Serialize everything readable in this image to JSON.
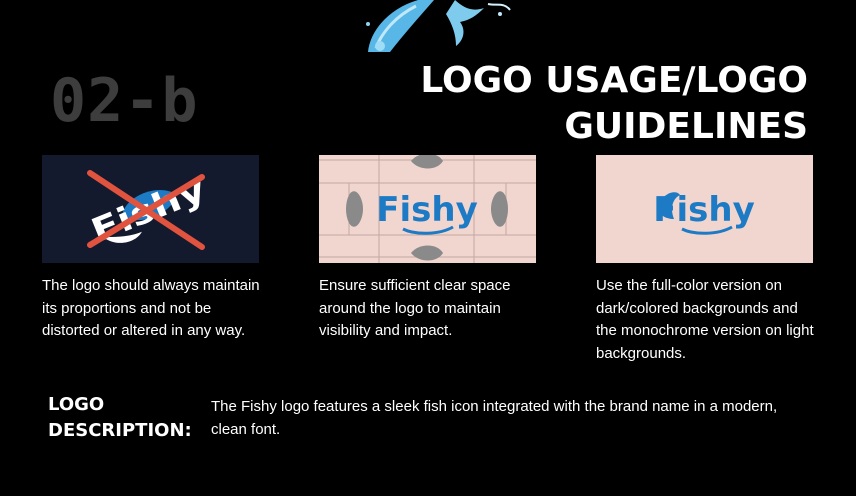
{
  "header": {
    "section_number": "02-b",
    "title": "LOGO USAGE/LOGO GUIDELINES"
  },
  "logo": {
    "wordmark": "Fishy",
    "brand_blue": "#1d7ac4",
    "dark_bg": "#131a2e",
    "light_bg": "#f1d5cf",
    "cross_color": "#e0533f"
  },
  "guidelines": [
    {
      "caption": "The logo should always maintain its proportions and not be distorted or altered in any way.",
      "visual": "distorted-logo-crossed-out"
    },
    {
      "caption": "Ensure sufficient clear space around the logo to maintain visibility and impact.",
      "visual": "clear-space-grid"
    },
    {
      "caption": "Use the full-color version on dark/colored backgrounds and the monochrome version on light backgrounds.",
      "visual": "full-color-logo"
    }
  ],
  "description": {
    "label": "LOGO DESCRIPTION:",
    "text": "The Fishy logo features a sleek fish icon integrated with the brand name in a modern, clean font."
  }
}
